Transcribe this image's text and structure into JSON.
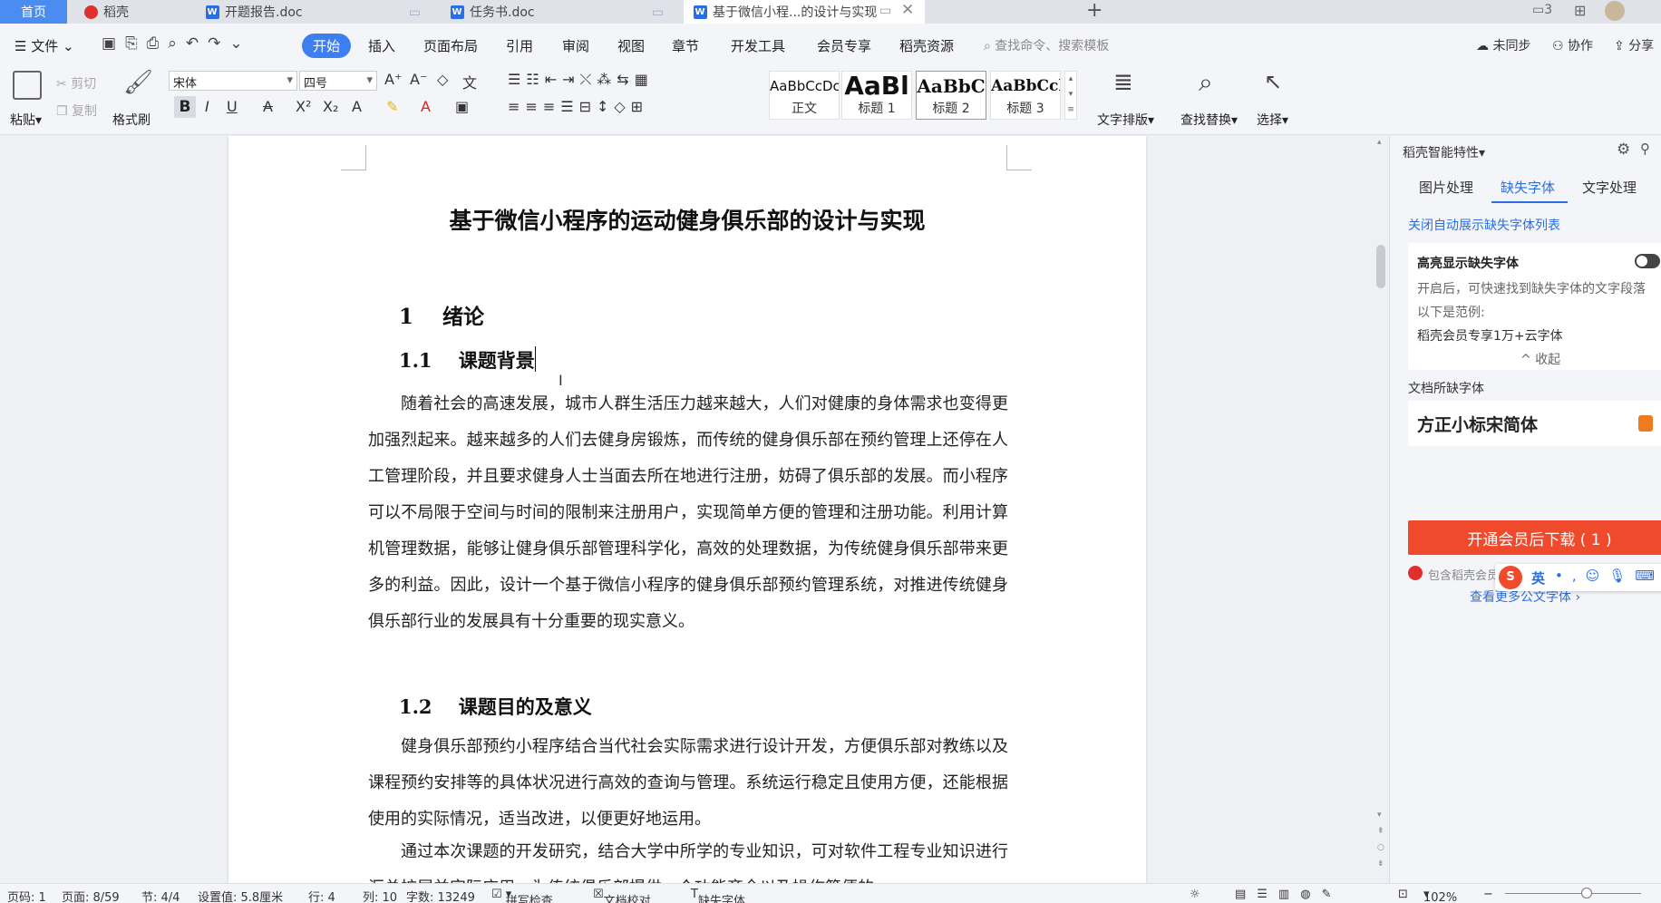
{
  "tabs": {
    "home": "首页",
    "items": [
      {
        "label": "稻壳",
        "icon": "docer-icon"
      },
      {
        "label": "开题报告.doc",
        "icon": "word-icon"
      },
      {
        "label": "任务书.doc",
        "icon": "word-icon"
      },
      {
        "label": "基于微信小程...的设计与实现",
        "icon": "word-icon"
      }
    ],
    "window_badge": "3"
  },
  "menu": {
    "file": "文件",
    "items": [
      "开始",
      "插入",
      "页面布局",
      "引用",
      "审阅",
      "视图",
      "章节",
      "开发工具",
      "会员专享",
      "稻壳资源"
    ],
    "active": "开始",
    "search_placeholder": "查找命令、搜索模板",
    "sync": "未同步",
    "collab": "协作",
    "share": "分享"
  },
  "ribbon": {
    "paste": "粘贴",
    "cut": "剪切",
    "copy": "复制",
    "format_painter": "格式刷",
    "font_name": "宋体",
    "font_size": "四号",
    "styles": [
      {
        "sample": "AaBbCcDc",
        "name": "正文"
      },
      {
        "sample": "AaBl",
        "name": "标题 1"
      },
      {
        "sample": "AaBbC",
        "name": "标题 2"
      },
      {
        "sample": "AaBbCcl",
        "name": "标题 3"
      }
    ],
    "text_layout": "文字排版",
    "find_replace": "查找替换",
    "select": "选择"
  },
  "document": {
    "title": "基于微信小程序的运动健身俱乐部的设计与实现",
    "h1_num": "1",
    "h1_text": "绪论",
    "h2a_num": "1.1",
    "h2a_text": "课题背景",
    "para1": "随着社会的高速发展，城市人群生活压力越来越大，人们对健康的身体需求也变得更加强烈起来。越来越多的人们去健身房锻炼，而传统的健身俱乐部在预约管理上还停在人工管理阶段，并且要求健身人士当面去所在地进行注册，妨碍了俱乐部的发展。而小程序可以不局限于空间与时间的限制来注册用户，实现简单方便的管理和注册功能。利用计算机管理数据，能够让健身俱乐部管理科学化，高效的处理数据，为传统健身俱乐部带来更多的利益。因此，设计一个基于微信小程序的健身俱乐部预约管理系统，对推进传统健身俱乐部行业的发展具有十分重要的现实意义。",
    "h2b_num": "1.2",
    "h2b_text": "课题目的及意义",
    "para2": "健身俱乐部预约小程序结合当代社会实际需求进行设计开发，方便俱乐部对教练以及课程预约安排等的具体状况进行高效的查询与管理。系统运行稳定且使用方便，还能根据使用的实际情况，适当改进，以便更好地运用。",
    "para3": "通过本次课题的开发研究，结合大学中所学的专业知识，可对软件工程专业知识进行汇总扩展并实际应用，为传统俱乐部提供一个功能齐全以及操作简便的"
  },
  "side": {
    "header": "稻壳智能特性",
    "tabs": [
      "图片处理",
      "缺失字体",
      "文字处理"
    ],
    "active_tab": "缺失字体",
    "close_auto": "关闭自动展示缺失字体列表",
    "highlight_title": "高亮显示缺失字体",
    "highlight_desc": "开启后，可快速找到缺失字体的文字段落",
    "example_label": "以下是范例:",
    "example_text": "稻壳会员专享1万+云字体",
    "collapse": "收起",
    "missing_label": "文档所缺字体",
    "missing_font": "方正小标宋简体",
    "download_button": "开通会员后下载 ( 1 )",
    "note": "包含稻壳会员专享字体，需开通稻壳会",
    "more_link": "查看更多公文字体",
    "ime": "英"
  },
  "status": {
    "page_code": "页码: 1",
    "page": "页面: 8/59",
    "section": "节: 4/4",
    "setting": "设置值: 5.8厘米",
    "row": "行: 4",
    "col": "列: 10",
    "wordcount": "字数: 13249",
    "spell": "拼写检查",
    "proof": "文档校对",
    "missing_font": "缺失字体",
    "zoom": "102%"
  }
}
